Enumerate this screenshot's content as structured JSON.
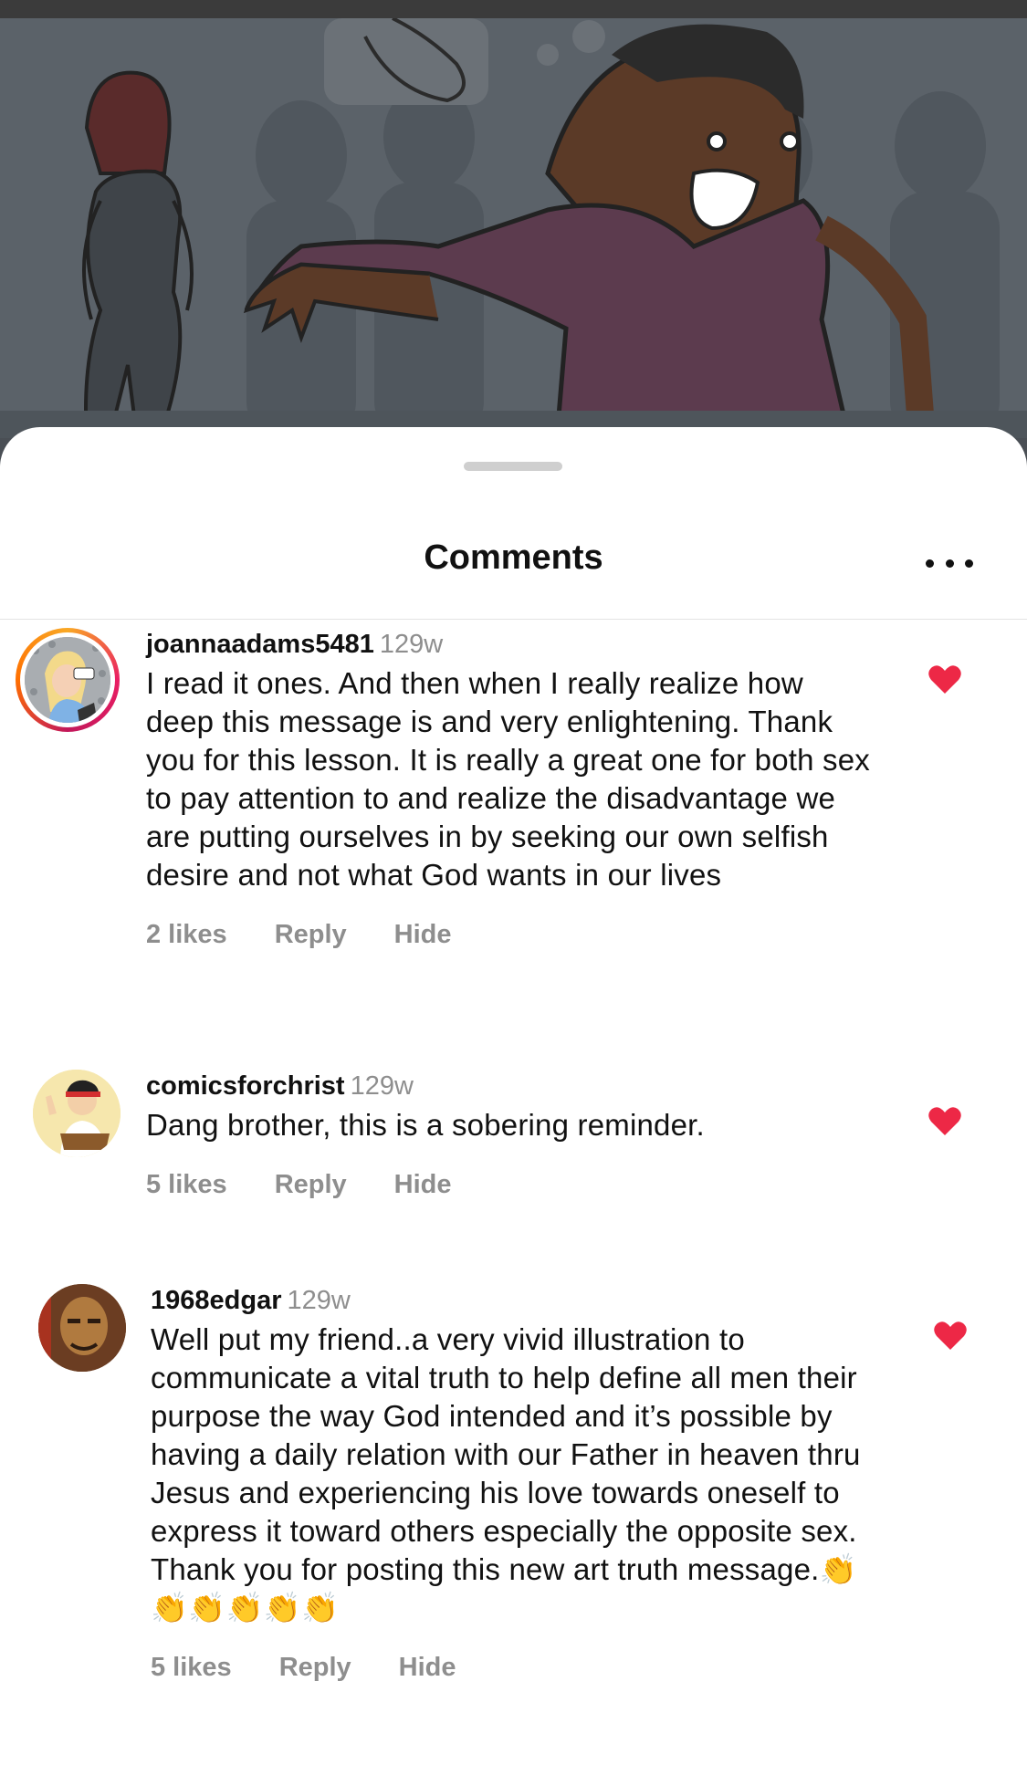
{
  "sheet": {
    "title": "Comments"
  },
  "comments": [
    {
      "username": "joannaadams5481",
      "time": "129w",
      "text": "I read it ones. And then when I really realize how deep this message is and very enlightening. Thank you for this lesson. It is really a great one for both sex to pay attention to and realize the disadvantage we are putting ourselves in by seeking our own selfish desire and not what God wants in our lives",
      "likes": "2 likes",
      "reply": "Reply",
      "hide": "Hide",
      "liked": true
    },
    {
      "username": "comicsforchrist",
      "time": "129w",
      "text": "Dang brother, this is a sobering reminder.",
      "likes": "5 likes",
      "reply": "Reply",
      "hide": "Hide",
      "liked": true
    },
    {
      "username": "1968edgar",
      "time": "129w",
      "text": "Well put my friend..a very vivid illustration to communicate a vital truth to help define all men their purpose the way God intended and it’s possible by having a daily relation with our Father in heaven thru Jesus and experiencing his love towards oneself to express it toward others especially the opposite sex. Thank you for posting this new art truth message.👏👏👏👏👏👏",
      "likes": "5 likes",
      "reply": "Reply",
      "hide": "Hide",
      "liked": true
    }
  ],
  "colors": {
    "like": "#ed2846",
    "meta": "#8e8e8e"
  }
}
